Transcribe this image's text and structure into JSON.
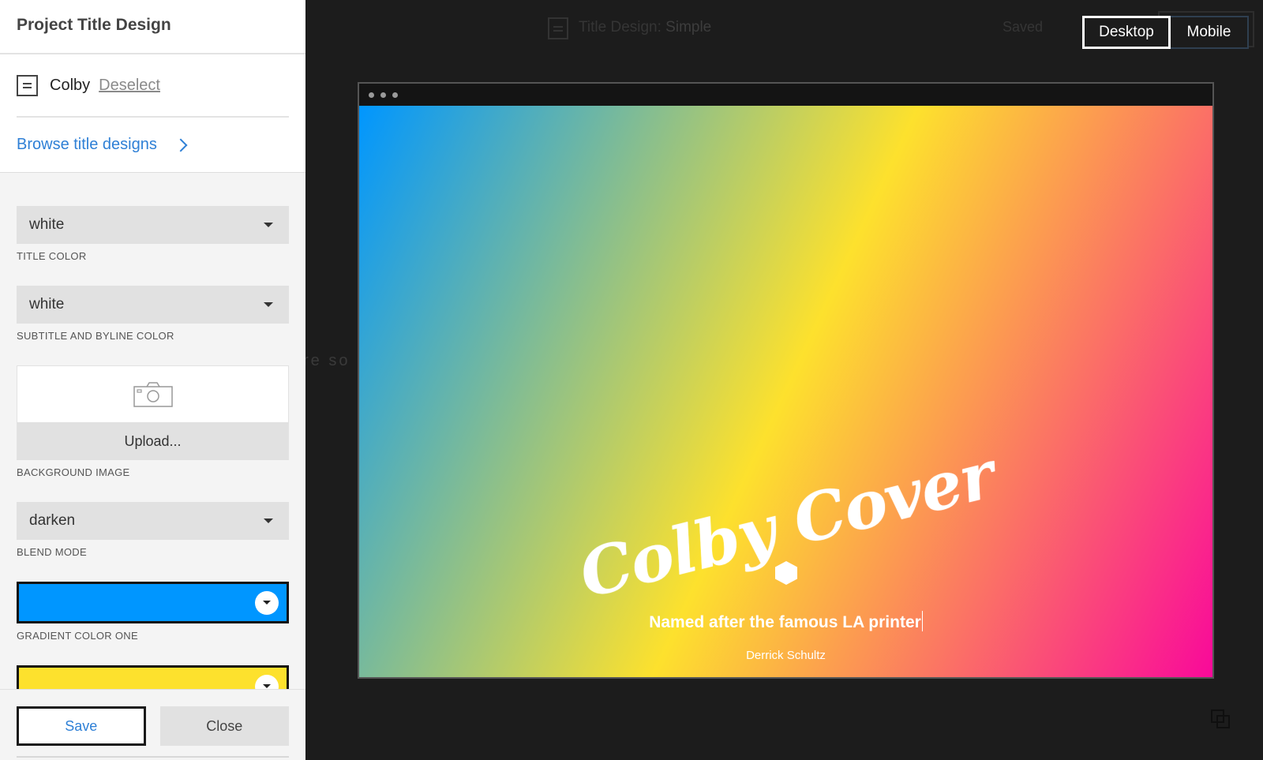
{
  "background_app": {
    "title_prefix": "Title Design:",
    "title_value": "Simple",
    "status": "Saved",
    "partial_text": "re so"
  },
  "view_toggle": {
    "desktop_label": "Desktop",
    "mobile_label": "Mobile",
    "active": "Desktop"
  },
  "panel": {
    "title": "Project Title Design",
    "selected_name": "Colby",
    "deselect_label": "Deselect",
    "browse_label": "Browse title designs",
    "fields": {
      "title_color": {
        "value": "white",
        "label": "TITLE COLOR"
      },
      "subtitle_color": {
        "value": "white",
        "label": "SUBTITLE AND BYLINE COLOR"
      },
      "background_image": {
        "upload_label": "Upload...",
        "label": "BACKGROUND IMAGE"
      },
      "blend_mode": {
        "value": "darken",
        "label": "BLEND MODE"
      },
      "gradient_one": {
        "color": "#0096ff",
        "label": "GRADIENT COLOR ONE"
      },
      "gradient_two": {
        "color": "#fde12d"
      }
    },
    "save_label": "Save",
    "close_label": "Close"
  },
  "preview": {
    "title": "Colby Cover",
    "subtitle": "Named after the famous LA printer",
    "byline": "Derrick Schultz",
    "gradient_colors": [
      "#0096ff",
      "#fde12d",
      "#f9099a"
    ]
  },
  "colors": {
    "accent": "#2f80d6",
    "dark_bg": "#1c1c1c"
  }
}
